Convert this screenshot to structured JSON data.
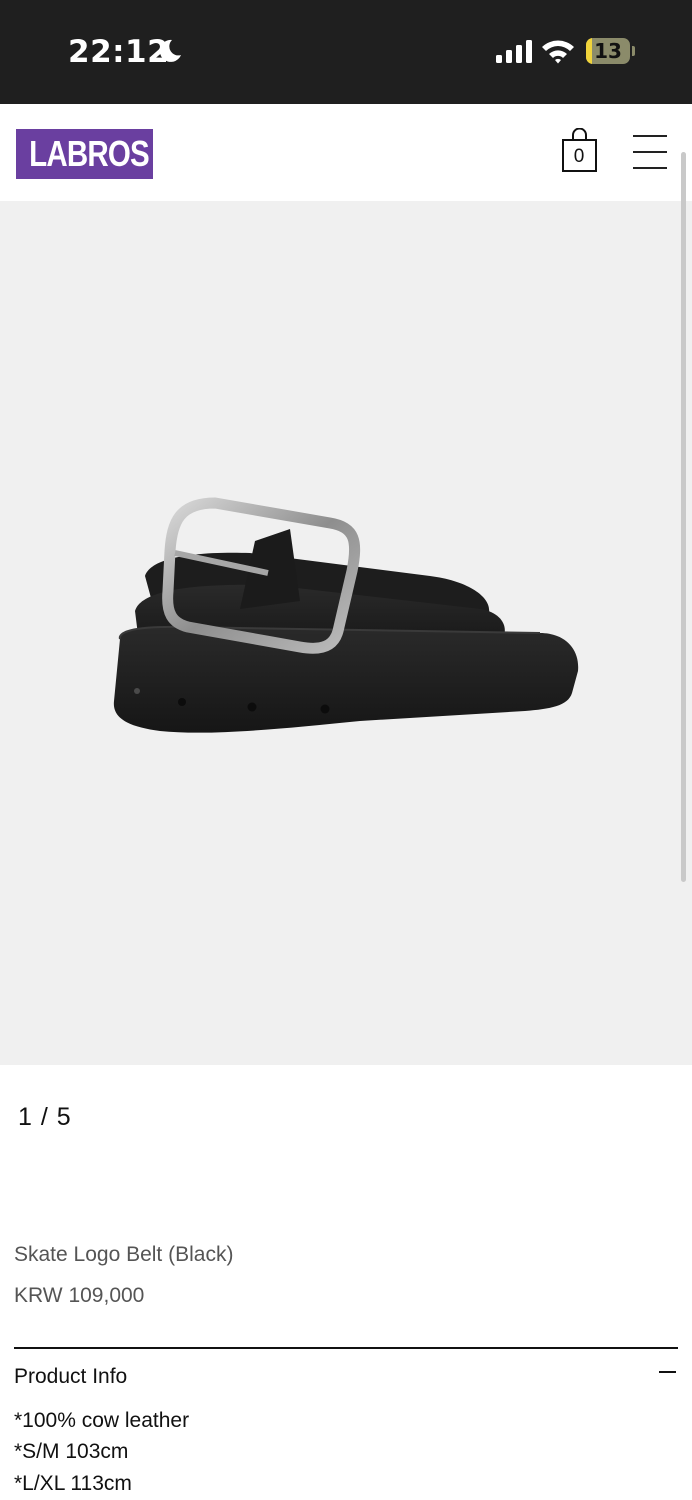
{
  "status_bar": {
    "time": "22:12",
    "battery": "13",
    "battery_level_percent": 13,
    "icons": [
      "moon-icon",
      "signal-icon",
      "wifi-icon",
      "battery-icon"
    ]
  },
  "header": {
    "logo": "LABROS",
    "brand_color": "#6a3fa0",
    "cart_count": "0",
    "icons": [
      "shopping-bag-icon",
      "hamburger-menu-icon"
    ]
  },
  "gallery": {
    "counter": "1 / 5",
    "background_color": "#f0f0f0"
  },
  "product": {
    "name": "Skate Logo Belt (Black)",
    "price": "KRW 109,000"
  },
  "product_info": {
    "title": "Product Info",
    "lines": [
      "*100% cow leather",
      "*S/M 103cm",
      "*L/XL 113cm"
    ]
  }
}
